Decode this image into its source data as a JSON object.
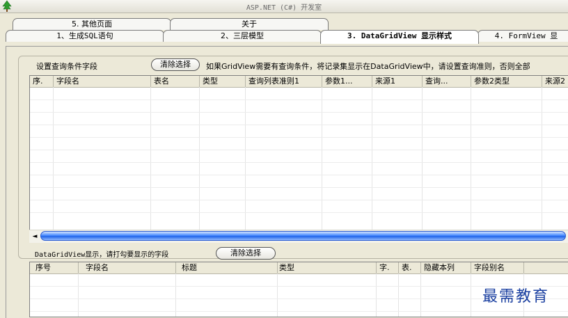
{
  "window": {
    "title": "ASP.NET (C#) 开发室"
  },
  "tabs_row1": [
    {
      "label": "5. 其他页面"
    },
    {
      "label": "关于"
    }
  ],
  "tabs_row2": [
    {
      "label": "1、生成SQL语句"
    },
    {
      "label": "2、三层模型"
    },
    {
      "label": "3. DataGridView 显示样式"
    },
    {
      "label": "4. FormView 显"
    }
  ],
  "query_section": {
    "label": "设置查询条件字段",
    "clear_button": "清除选择",
    "hint": "如果GridView需要有查询条件，将记录集显示在DataGridView中，请设置查询准则，否则全部",
    "columns": [
      "序.",
      "字段名",
      "表名",
      "类型",
      "查询列表准则1",
      "参数1...",
      "来源1",
      "查询...",
      "参数2类型",
      "来源2"
    ]
  },
  "display_section": {
    "label": "DataGridView显示，请打勾要显示的字段",
    "clear_button": "清除选择",
    "columns": [
      "序号",
      "字段名",
      "标题",
      "类型",
      "字.",
      "表.",
      "隐藏本列",
      "字段别名"
    ]
  },
  "scrollbar": {
    "left_arrow": "◄"
  },
  "watermark": "最需教育"
}
